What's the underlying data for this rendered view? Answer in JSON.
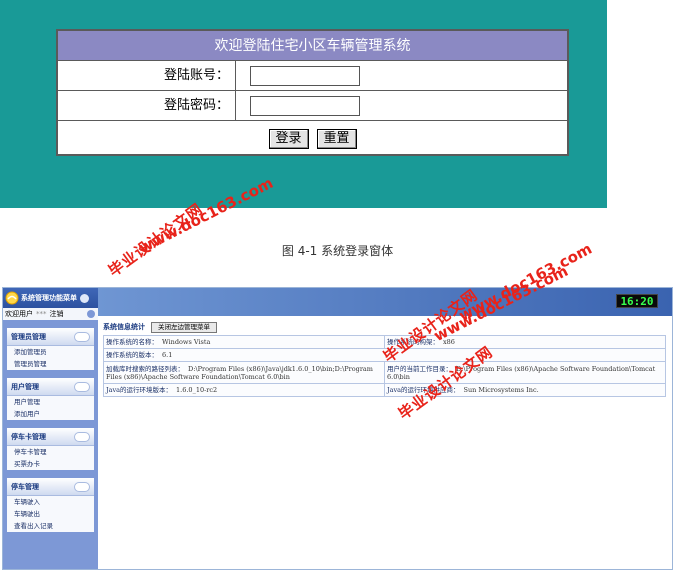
{
  "login": {
    "title": "欢迎登陆住宅小区车辆管理系统",
    "account_label": "登陆账号：",
    "password_label": "登陆密码：",
    "account_value": "",
    "password_value": "",
    "login_button": "登录",
    "reset_button": "重置"
  },
  "caption": "图 4-1 系统登录窗体",
  "watermark": {
    "site": "www.doc163.com",
    "name": "毕业设计论文网"
  },
  "admin": {
    "clock": "16:20",
    "sidebar_title": "系统管理功能菜单",
    "welcome": "欢迎用户",
    "username": "***",
    "logout": "注销",
    "groups": [
      {
        "title": "管理员管理",
        "items": [
          "添加管理员",
          "管理员管理"
        ]
      },
      {
        "title": "用户管理",
        "items": [
          "用户管理",
          "添加用户"
        ]
      },
      {
        "title": "停车卡管理",
        "items": [
          "停车卡管理",
          "买票办卡"
        ]
      },
      {
        "title": "停车管理",
        "items": [
          "车辆驶入",
          "车辆驶出",
          "查看出入记录"
        ]
      }
    ],
    "section_title": "系统信息统计",
    "close_menu_button": "关闭左边管理菜单",
    "info": {
      "os_name_label": "操作系统的名称：",
      "os_name": "Windows Vista",
      "os_arch_label": "操作系统的构架：",
      "os_arch": "x86",
      "os_version_label": "操作系统的版本：",
      "os_version": "6.1",
      "lib_path_label": "加载库时搜索的路径列表：",
      "lib_path": "D:\\Program Files (x86)\\Java\\jdk1.6.0_10\\bin;D:\\Program Files (x86)\\Apache Software Foundation\\Tomcat 6.0\\bin",
      "user_dir_label": "用户的当前工作目录：",
      "user_dir": "D:\\Program Files (x86)\\Apache Software Foundation\\Tomcat 6.0\\bin",
      "java_version_label": "Java的运行环境版本：",
      "java_version": "1.6.0_10-rc2",
      "java_vendor_label": "Java的运行环境供应商：",
      "java_vendor": "Sun Microsystems Inc."
    }
  },
  "colors": {
    "login_bg": "#199a97",
    "login_title_bg": "#8b89c3",
    "sidebar_bg": "#7d98d6",
    "banner": "#3a63b0",
    "watermark": "#e8231a",
    "clock_text": "#37ff4e"
  }
}
